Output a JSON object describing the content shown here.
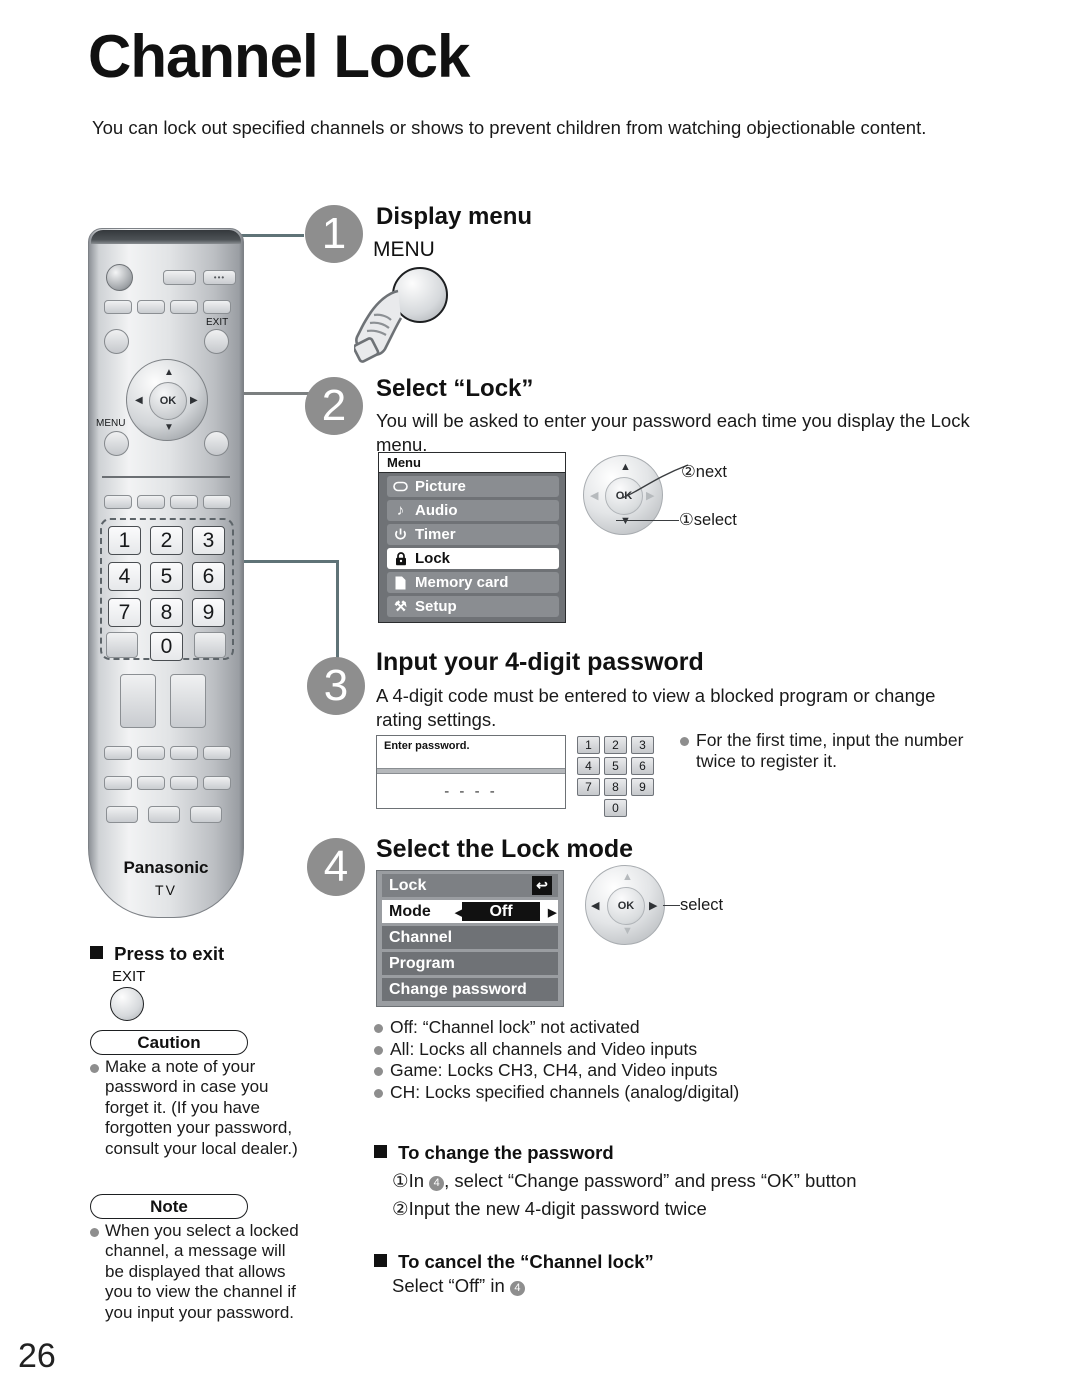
{
  "page": {
    "title": "Channel Lock",
    "intro": "You can lock out specified channels or shows to prevent children from watching objectionable content.",
    "number": "26"
  },
  "remote": {
    "menu_label": "MENU",
    "exit_label": "EXIT",
    "ok_label": "OK",
    "brand": "Panasonic",
    "brand_sub": "TV",
    "keypad": [
      "1",
      "2",
      "3",
      "4",
      "5",
      "6",
      "7",
      "8",
      "9",
      "0"
    ],
    "dots_icon": "•••"
  },
  "steps": [
    {
      "num": "1",
      "heading": "Display menu",
      "button_label": "MENU"
    },
    {
      "num": "2",
      "heading": "Select “Lock”",
      "body": "You will be asked to enter your password each time you display the Lock menu."
    },
    {
      "num": "3",
      "heading": "Input your 4-digit password",
      "body": "A 4-digit code must be entered to view a blocked program or change rating settings."
    },
    {
      "num": "4",
      "heading": "Select the Lock mode"
    }
  ],
  "tv_menu": {
    "title": "Menu",
    "items": [
      {
        "label": "Picture",
        "icon": "picture-icon",
        "glyph": "▭",
        "selected": false
      },
      {
        "label": "Audio",
        "icon": "note-icon",
        "glyph": "♪",
        "selected": false
      },
      {
        "label": "Timer",
        "icon": "power-icon",
        "glyph": "⏻",
        "selected": false
      },
      {
        "label": "Lock",
        "icon": "padlock-icon",
        "glyph": "🔒",
        "selected": true
      },
      {
        "label": "Memory card",
        "icon": "card-icon",
        "glyph": "▮",
        "selected": false
      },
      {
        "label": "Setup",
        "icon": "wrench-icon",
        "glyph": "⚒",
        "selected": false
      }
    ]
  },
  "menu_pad_callouts": {
    "next": "②next",
    "select": "①select"
  },
  "password_dialog": {
    "prompt": "Enter password.",
    "masked_value": "- - - -",
    "keys": [
      "1",
      "2",
      "3",
      "4",
      "5",
      "6",
      "7",
      "8",
      "9",
      "0"
    ],
    "note": "For the first time, input the number twice to register it."
  },
  "lock_panel": {
    "title": "Lock",
    "back_icon": "↩",
    "rows": [
      {
        "label": "Mode",
        "value": "Off",
        "type": "setting"
      },
      {
        "label": "Channel",
        "value": "",
        "type": "item"
      },
      {
        "label": "Program",
        "value": "",
        "type": "item"
      },
      {
        "label": "Change password",
        "value": "",
        "type": "item"
      }
    ],
    "pad_callout": "select"
  },
  "mode_bullets": [
    "Off: “Channel lock” not activated",
    "All: Locks all channels and Video inputs",
    "Game: Locks CH3, CH4, and Video inputs",
    "CH: Locks specified channels (analog/digital)"
  ],
  "change_password": {
    "heading": "To change the password",
    "line1_pre": "①In ",
    "line1_badge": "4",
    "line1_post": ", select “Change password” and press “OK” button",
    "line2": "②Input the new 4-digit password twice"
  },
  "cancel_lock": {
    "heading": "To cancel the “Channel lock”",
    "line_pre": "Select “Off” in ",
    "line_badge": "4"
  },
  "left_column": {
    "press_to_exit": "Press to exit",
    "exit_label": "EXIT",
    "caution_title": "Caution",
    "caution_text": "Make a note of your password in case you forget it. (If you have forgotten your password, consult your local dealer.)",
    "note_title": "Note",
    "note_text": "When you select a locked channel, a message will be displayed that allows you to view the channel if you input your password."
  },
  "colors": {
    "step_circle": "#8e8e8e",
    "connector": "#5f7377",
    "menu_bg": "#6f7276",
    "menu_row": "#8a8d91",
    "selected_value": "#111111"
  }
}
